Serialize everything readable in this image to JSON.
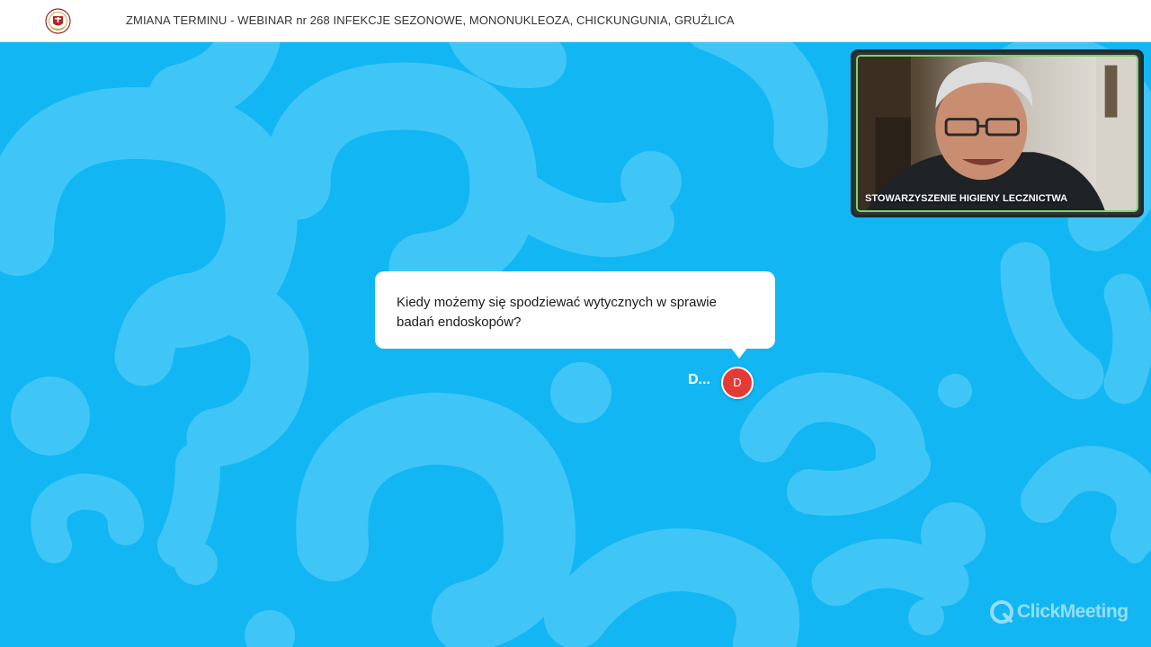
{
  "header": {
    "title": "ZMIANA TERMINU - WEBINAR nr 268 INFEKCJE SEZONOWE, MONONUKLEOZA, CHICKUNGUNIA, GRUŹLICA"
  },
  "video": {
    "participant_name": "STOWARZYSZENIE HIGIENY LECZNICTWA"
  },
  "question": {
    "text": "Kiedy możemy się spodziewać wytycznych w sprawie badań endoskopów?",
    "asker_name": "D...",
    "avatar_initial": "D"
  },
  "branding": {
    "watermark": "ClickMeeting"
  },
  "colors": {
    "background": "#12b6f2",
    "pattern": "#3fc6f7",
    "avatar": "#e53935",
    "video_border": "#7dd36a"
  },
  "icons": [
    "logo-icon",
    "question-mark-pattern",
    "clickmeeting-logo-icon"
  ]
}
